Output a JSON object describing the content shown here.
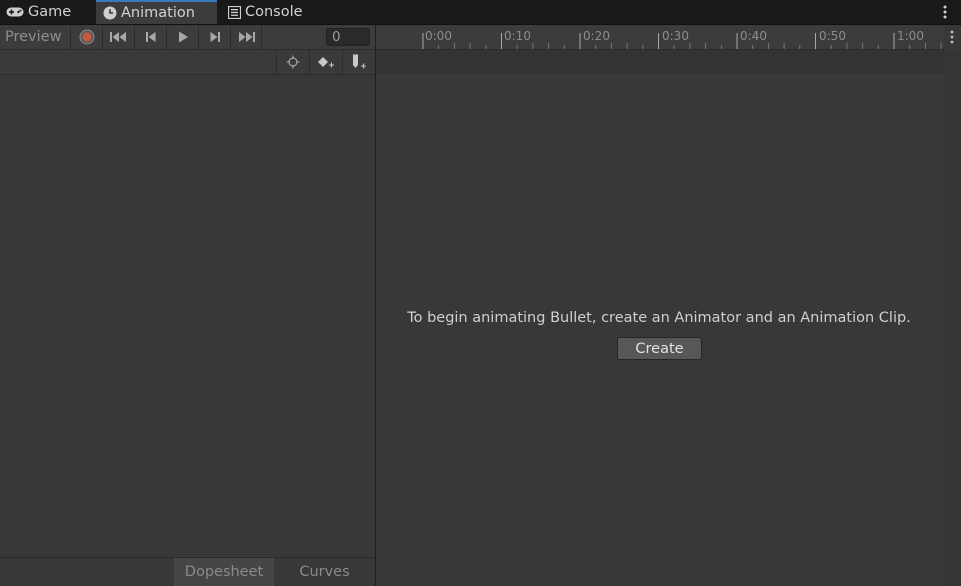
{
  "tabs": [
    {
      "label": "Game",
      "icon": "gamepad-icon",
      "active": false
    },
    {
      "label": "Animation",
      "icon": "clock-icon",
      "active": true
    },
    {
      "label": "Console",
      "icon": "console-icon",
      "active": false
    }
  ],
  "toolbar": {
    "preview_label": "Preview",
    "frame_value": "0",
    "record_color": "#c5583d"
  },
  "timeline": {
    "labels": [
      "0:00",
      "0:10",
      "0:20",
      "0:30",
      "0:40",
      "0:50",
      "1:00"
    ]
  },
  "empty_state": {
    "message": "To begin animating Bullet, create an Animator and an Animation Clip.",
    "create_label": "Create"
  },
  "bottom_tabs": {
    "dopesheet": "Dopesheet",
    "curves": "Curves"
  },
  "colors": {
    "accent": "#3a79bb",
    "panel": "#383838",
    "tabbar": "#191919"
  }
}
